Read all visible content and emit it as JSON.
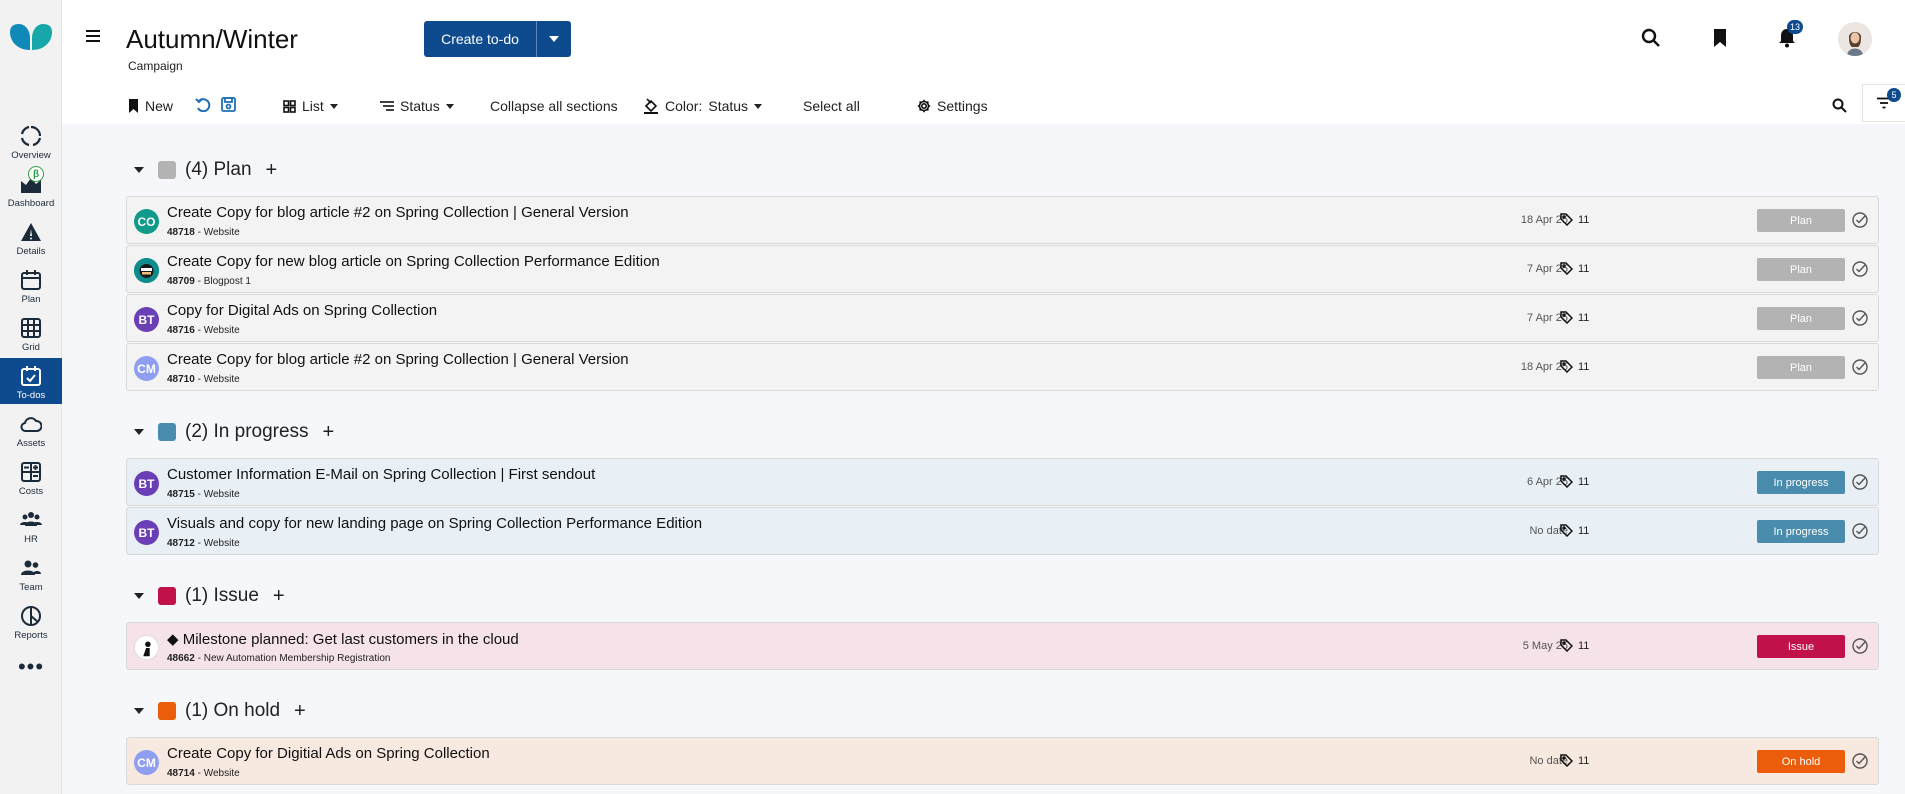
{
  "sidebar": {
    "items": [
      {
        "label": "Overview",
        "icon": "overview-icon"
      },
      {
        "label": "Dashboard",
        "icon": "dashboard-icon",
        "badge": "β"
      },
      {
        "label": "Details",
        "icon": "warning-triangle-icon"
      },
      {
        "label": "Plan",
        "icon": "calendar-icon"
      },
      {
        "label": "Grid",
        "icon": "grid-icon"
      },
      {
        "label": "To-dos",
        "icon": "calendar-check-icon",
        "active": true
      },
      {
        "label": "Assets",
        "icon": "cloud-icon"
      },
      {
        "label": "Costs",
        "icon": "calculator-icon"
      },
      {
        "label": "HR",
        "icon": "people-icon"
      },
      {
        "label": "Team",
        "icon": "team-icon"
      },
      {
        "label": "Reports",
        "icon": "pie-chart-icon"
      }
    ],
    "more": "•••"
  },
  "header": {
    "title": "Autumn/Winter",
    "subtitle": "Campaign",
    "create_label": "Create to-do",
    "notification_count": "13"
  },
  "toolbar": {
    "new_label": "New",
    "view_label": "List",
    "group_label": "Status",
    "collapse_label": "Collapse all sections",
    "color_prefix": "Color:",
    "color_value": "Status",
    "select_all_label": "Select all",
    "settings_label": "Settings",
    "filter_count": "5"
  },
  "colors": {
    "primary": "#0e4b8e",
    "plan": "#b3b3b3",
    "in_progress": "#4a8cad",
    "issue": "#c0114a",
    "on_hold": "#eb5d0a"
  },
  "sections": [
    {
      "header": "(4) Plan",
      "rows": [
        {
          "title": "Create Copy for blog article #2 on Spring Collection | General Version",
          "id": "48718",
          "sep": "-",
          "channel": "Website",
          "date": "18 Apr 25",
          "tags": "11",
          "status": "Plan",
          "avatar": "CO"
        },
        {
          "title": "Create Copy for new blog article on Spring Collection Performance Edition",
          "id": "48709",
          "sep": "-",
          "channel": "Blogpost 1",
          "date": "7 Apr 25",
          "tags": "11",
          "status": "Plan",
          "avatar": ""
        },
        {
          "title": "Copy for Digital Ads on Spring Collection",
          "id": "48716",
          "sep": "-",
          "channel": "Website",
          "date": "7 Apr 25",
          "tags": "11",
          "status": "Plan",
          "avatar": "BT"
        },
        {
          "title": "Create Copy for blog article #2 on Spring Collection | General Version",
          "id": "48710",
          "sep": "-",
          "channel": "Website",
          "date": "18 Apr 25",
          "tags": "11",
          "status": "Plan",
          "avatar": "CM"
        }
      ]
    },
    {
      "header": "(2) In progress",
      "rows": [
        {
          "title": "Customer Information E-Mail on Spring Collection | First sendout",
          "id": "48715",
          "sep": "-",
          "channel": "Website",
          "date": "6 Apr 25",
          "tags": "11",
          "status": "In progress",
          "avatar": "BT"
        },
        {
          "title": "Visuals and copy for new landing page on Spring Collection Performance Edition",
          "id": "48712",
          "sep": "-",
          "channel": "Website",
          "date": "No date",
          "tags": "11",
          "status": "In progress",
          "avatar": "BT"
        }
      ]
    },
    {
      "header": "(1) Issue",
      "rows": [
        {
          "title": "◆ Milestone planned: Get last customers in the cloud",
          "id": "48662",
          "sep": "-",
          "channel": "New Automation Membership Registration",
          "date": "5 May 25",
          "tags": "11",
          "status": "Issue",
          "avatar": ""
        }
      ]
    },
    {
      "header": "(1) On hold",
      "rows": [
        {
          "title": "Create Copy for Digitial Ads on Spring Collection",
          "id": "48714",
          "sep": "-",
          "channel": "Website",
          "date": "No date",
          "tags": "11",
          "status": "On hold",
          "avatar": "CM"
        }
      ]
    }
  ]
}
